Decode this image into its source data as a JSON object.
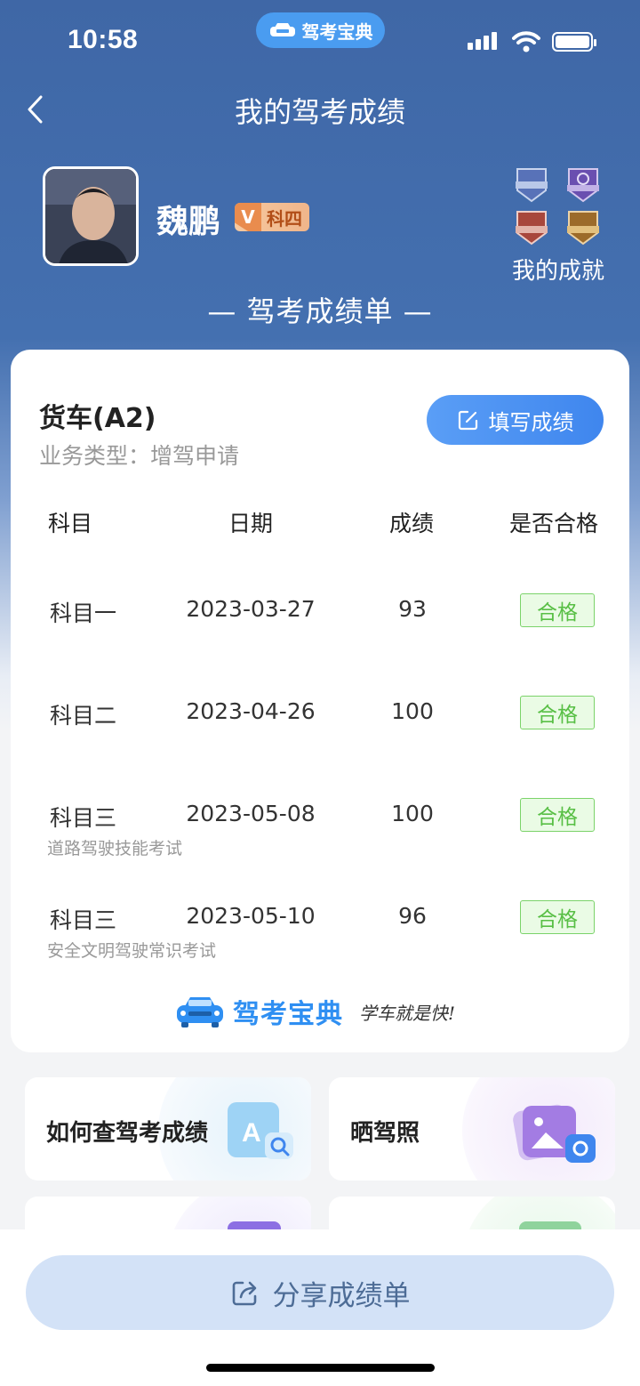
{
  "status_bar": {
    "time": "10:58",
    "app_pill": "驾考宝典"
  },
  "nav": {
    "title": "我的驾考成绩"
  },
  "profile": {
    "name": "魏鹏",
    "vip_letter": "V",
    "vip_level": "科四",
    "achievements_label": "我的成就"
  },
  "sheet_title": "— 驾考成绩单 —",
  "card": {
    "vehicle_type": "货车(A2)",
    "business_type": "业务类型：增驾申请",
    "fill_button": "填写成绩",
    "headers": {
      "subject": "科目",
      "date": "日期",
      "score": "成绩",
      "pass": "是否合格"
    },
    "rows": [
      {
        "subject": "科目一",
        "note": "",
        "date": "2023-03-27",
        "score": "93",
        "pass": "合格"
      },
      {
        "subject": "科目二",
        "note": "",
        "date": "2023-04-26",
        "score": "100",
        "pass": "合格"
      },
      {
        "subject": "科目三",
        "note": "道路驾驶技能考试",
        "date": "2023-05-08",
        "score": "100",
        "pass": "合格"
      },
      {
        "subject": "科目三",
        "note": "安全文明驾驶常识考试",
        "date": "2023-05-10",
        "score": "96",
        "pass": "合格"
      }
    ],
    "brand_name": "驾考宝典",
    "brand_slogan": "学车就是快!"
  },
  "tiles": [
    {
      "label": "如何查驾考成绩"
    },
    {
      "label": "晒驾照"
    }
  ],
  "share_button": "分享成绩单",
  "colors": {
    "header_blue": "#4470b0",
    "accent_blue": "#3f86ee",
    "pass_green": "#58bf45"
  }
}
